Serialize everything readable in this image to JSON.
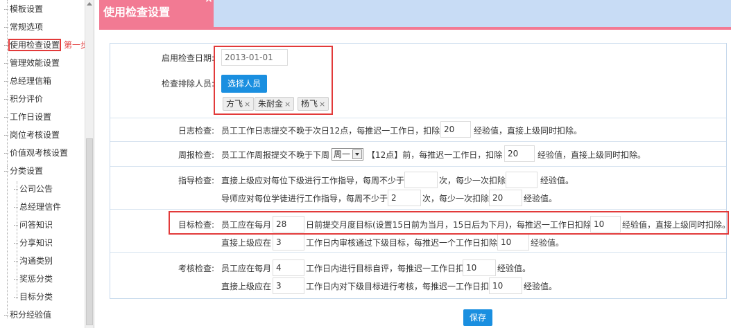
{
  "sidebar": {
    "items": [
      {
        "label": "模板设置"
      },
      {
        "label": "常规选项"
      },
      {
        "label": "使用检查设置"
      },
      {
        "label": "管理效能设置"
      },
      {
        "label": "总经理信箱"
      },
      {
        "label": "积分评价"
      },
      {
        "label": "工作日设置"
      },
      {
        "label": "岗位考核设置"
      },
      {
        "label": "价值观考核设置"
      },
      {
        "label": "分类设置"
      },
      {
        "label": "公司公告"
      },
      {
        "label": "总经理信件"
      },
      {
        "label": "问答知识"
      },
      {
        "label": "分享知识"
      },
      {
        "label": "沟通类别"
      },
      {
        "label": "奖惩分类"
      },
      {
        "label": "目标分类"
      },
      {
        "label": "积分经验值"
      }
    ],
    "step_note": "第一步"
  },
  "tab": {
    "title": "使用检查设置",
    "close": "×"
  },
  "form": {
    "start_date": {
      "label": "启用检查日期:",
      "value": "2013-01-01"
    },
    "exclude": {
      "label": "检查排除人员:",
      "button": "选择人员",
      "tags": [
        "方飞",
        "朱耐金",
        "杨飞"
      ],
      "tag_close": "×"
    },
    "daily": {
      "label": "日志检查:",
      "text1": "员工工作日志提交不晚于次日12点，每推迟一工作日，扣除",
      "value": "20",
      "text2": "经验值，直接上级同时扣除。"
    },
    "weekly": {
      "label": "周报检查:",
      "text1": "员工工作周报提交不晚于下周",
      "select": "周一",
      "text2": "【12点】前，每推迟一工作日，扣除",
      "value": "20",
      "text3": "经验值，直接上级同时扣除。"
    },
    "guide": {
      "label": "指导检查:",
      "line1_text1": "直接上级应对每位下级进行工作指导，每周不少于",
      "line1_v1": "",
      "line1_text2": "次，每少一次扣除",
      "line1_v2": "",
      "line1_text3": "经验值。",
      "line2_text1": "导师应对每位学徒进行工作指导，每周不少于",
      "line2_v1": "2",
      "line2_text2": "次，每少一次扣除",
      "line2_v2": "20",
      "line2_text3": "经验值。"
    },
    "target": {
      "label": "目标检查:",
      "line1_text1": "员工应在每月",
      "line1_v1": "28",
      "line1_text2": "日前提交月度目标(设置15日前为当月，15日后为下月)，每推迟一工作日扣除",
      "line1_v2": "10",
      "line1_text3": "经验值，直接上级同时扣除。",
      "line2_text1": "直接上级应在",
      "line2_v1": "3",
      "line2_text2": "工作日内审核通过下级目标，每推迟一个工作日扣除",
      "line2_v2": "10",
      "line2_text3": "经验值。"
    },
    "assess": {
      "label": "考核检查:",
      "line1_text1": "员工应在每月",
      "line1_v1": "4",
      "line1_text2": "工作日内进行目标自评，每推迟一工作日扣",
      "line1_v2": "10",
      "line1_text3": "经验值。",
      "line2_text1": "直接上级应在",
      "line2_v1": "3",
      "line2_text2": "工作日内对下级目标进行考核，每推迟一工作日扣",
      "line2_v2": "10",
      "line2_text3": "经验值。"
    },
    "save": "保存"
  },
  "colors": {
    "tab": "#f27a93",
    "topbar": "#c8dcf5",
    "button": "#1a8fe0",
    "highlight": "#e23a3a"
  }
}
